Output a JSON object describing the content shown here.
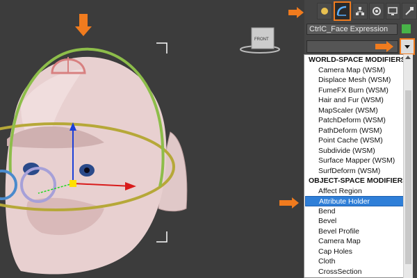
{
  "viewport": {
    "label": "viewport",
    "cube_label": "FRONT"
  },
  "command_panel": {
    "tabs": [
      {
        "icon": "modify-icon",
        "active": true
      },
      {
        "icon": "hierarchy-icon",
        "active": false
      },
      {
        "icon": "motion-icon",
        "active": false
      },
      {
        "icon": "display-icon",
        "active": false
      },
      {
        "icon": "utilities-icon",
        "active": false
      }
    ],
    "object_name": "CtrlC_Face Expression",
    "object_color": "#48b348",
    "modifier_list_value": ""
  },
  "modifier_list": [
    {
      "label": "WORLD-SPACE MODIFIERS",
      "type": "header"
    },
    {
      "label": "Camera Map (WSM)",
      "type": "item"
    },
    {
      "label": "Displace Mesh (WSM)",
      "type": "item"
    },
    {
      "label": "FumeFX Burn (WSM)",
      "type": "item"
    },
    {
      "label": "Hair and Fur (WSM)",
      "type": "item"
    },
    {
      "label": "MapScaler (WSM)",
      "type": "item"
    },
    {
      "label": "PatchDeform (WSM)",
      "type": "item"
    },
    {
      "label": "PathDeform (WSM)",
      "type": "item"
    },
    {
      "label": "Point Cache (WSM)",
      "type": "item"
    },
    {
      "label": "Subdivide (WSM)",
      "type": "item"
    },
    {
      "label": "Surface Mapper (WSM)",
      "type": "item"
    },
    {
      "label": "SurfDeform (WSM)",
      "type": "item"
    },
    {
      "label": "OBJECT-SPACE MODIFIERS",
      "type": "header"
    },
    {
      "label": "Affect Region",
      "type": "item"
    },
    {
      "label": "Attribute Holder",
      "type": "item",
      "selected": true
    },
    {
      "label": "Bend",
      "type": "item"
    },
    {
      "label": "Bevel",
      "type": "item"
    },
    {
      "label": "Bevel Profile",
      "type": "item"
    },
    {
      "label": "Camera Map",
      "type": "item"
    },
    {
      "label": "Cap Holes",
      "type": "item"
    },
    {
      "label": "Cloth",
      "type": "item"
    },
    {
      "label": "CrossSection",
      "type": "item"
    }
  ],
  "colors": {
    "highlight_arrow": "#f07b1e",
    "selection": "#2f7fd8"
  }
}
